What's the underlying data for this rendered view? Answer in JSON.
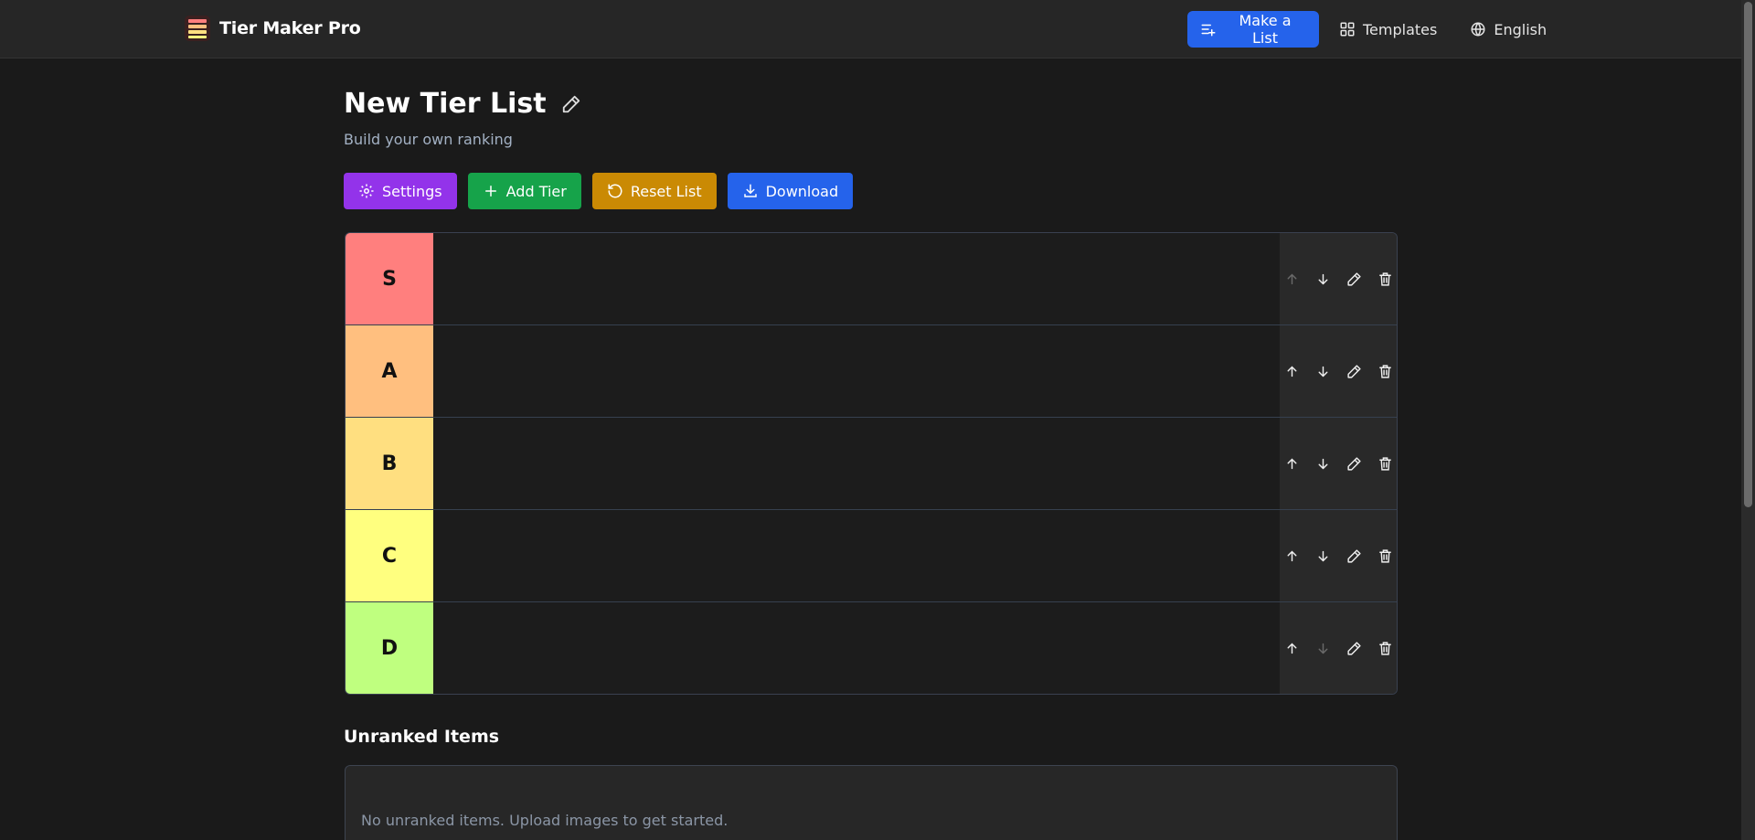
{
  "header": {
    "brand": "Tier Maker Pro",
    "nav": {
      "make_list": "Make a List",
      "templates": "Templates",
      "language": "English"
    }
  },
  "page": {
    "title": "New Tier List",
    "subtitle": "Build your own ranking"
  },
  "toolbar": {
    "settings": "Settings",
    "add_tier": "Add Tier",
    "reset": "Reset List",
    "download": "Download"
  },
  "tiers": [
    {
      "label": "S",
      "color": "#ff7f7e"
    },
    {
      "label": "A",
      "color": "#ffbf7f"
    },
    {
      "label": "B",
      "color": "#ffdf80"
    },
    {
      "label": "C",
      "color": "#ffff7f"
    },
    {
      "label": "D",
      "color": "#bfff7f"
    }
  ],
  "unranked": {
    "title": "Unranked Items",
    "empty_message": "No unranked items. Upload images to get started."
  },
  "colors": {
    "primary": "#2563eb",
    "settings": "#9333ea",
    "add_tier": "#16a34a",
    "reset": "#ca8a04",
    "download": "#2563eb"
  }
}
